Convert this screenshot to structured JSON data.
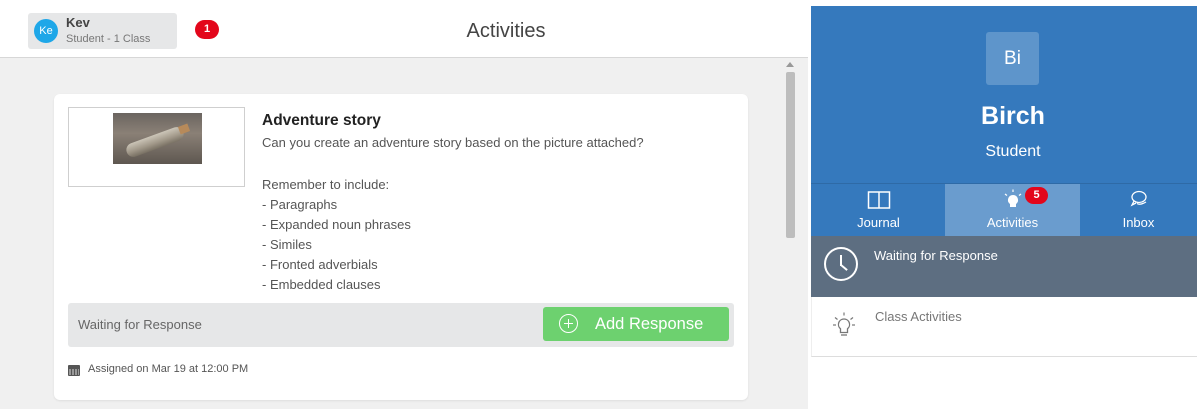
{
  "header": {
    "user": {
      "initials": "Ke",
      "name": "Kev",
      "subtitle": "Student - 1 Class",
      "badge": "1",
      "avatar_color": "#1ea7e8"
    },
    "title": "Activities"
  },
  "activity": {
    "title": "Adventure story",
    "description": "Can you create an adventure story based on the picture attached?",
    "instructions": [
      "",
      "Remember to include:",
      "- Paragraphs",
      "- Expanded noun phrases",
      "- Similes",
      "- Fronted adverbials",
      "- Embedded clauses"
    ],
    "status": "Waiting for Response",
    "add_response_label": "Add Response",
    "assigned": "Assigned on Mar 19 at 12:00 PM"
  },
  "profile": {
    "initials": "Bi",
    "name": "Birch",
    "role": "Student"
  },
  "tabs": [
    {
      "label": "Journal",
      "icon": "book-icon"
    },
    {
      "label": "Activities",
      "icon": "lightbulb-icon",
      "badge": "5"
    },
    {
      "label": "Inbox",
      "icon": "chat-bubbles-icon"
    }
  ],
  "filters": [
    {
      "label": "Waiting for Response",
      "icon": "clock-icon"
    },
    {
      "label": "Class Activities",
      "icon": "lightbulb-icon"
    }
  ],
  "colors": {
    "brand_blue": "#3579bd",
    "active_tab": "#6a9cce",
    "success_green": "#6dd16f",
    "badge_red": "#e3061b",
    "slate": "#5d6e81"
  }
}
